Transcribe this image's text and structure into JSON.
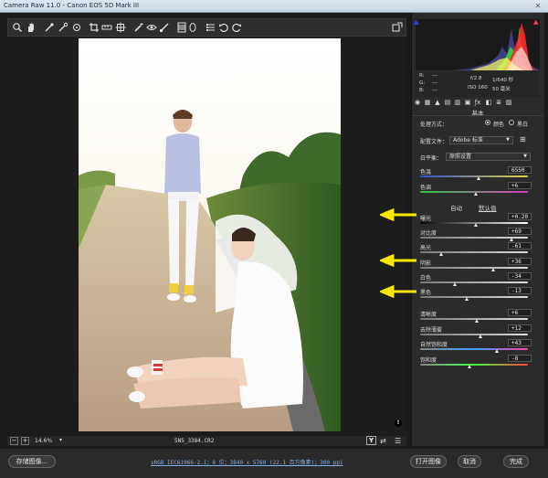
{
  "window": {
    "title": "Camera Raw 11.0  -  Canon EOS 5D Mark III",
    "close_glyph": "✕"
  },
  "toolbar": {
    "icons": [
      "zoom-icon",
      "hand-icon",
      "white-balance-icon",
      "color-sampler-icon",
      "targeted-adjustment-icon",
      "crop-icon",
      "straighten-icon",
      "transform-icon",
      "spot-removal-icon",
      "red-eye-icon",
      "adjustment-brush-icon",
      "graduated-filter-icon",
      "radial-filter-icon",
      "preferences-icon",
      "rotate-left-icon",
      "rotate-right-icon"
    ],
    "fullscreen_icon": "fullscreen-icon"
  },
  "preview": {
    "warning_glyph": "!"
  },
  "status": {
    "zoom_minus": "−",
    "zoom_plus": "+",
    "zoom": "14.6%",
    "zoom_arrow": "▾",
    "filename": "5N5_3384.CR2",
    "y_view": "Y",
    "compare_icon": "⇄",
    "settings_icon": "☰"
  },
  "bottom": {
    "save_label": "存储图像...",
    "workflow_link": "sRGB IEC61966-2.1；8 位；3840 x 5760 (22.1 百万像素)；300 ppi",
    "open_label": "打开图像",
    "cancel_label": "取消",
    "done_label": "完成"
  },
  "info": {
    "r_label": "R:",
    "r_val": "---",
    "g_label": "G:",
    "g_val": "---",
    "b_label": "B:",
    "b_val": "---",
    "aperture": "f/2.8",
    "shutter": "1/640 秒",
    "iso": "ISO 160",
    "focal": "50 毫米"
  },
  "panel": {
    "section_title": "基本",
    "treatment_label": "处理方式：",
    "color_label": "颜色",
    "bw_label": "黑白",
    "profile_label": "配置文件：",
    "profile_value": "Adobe 标准",
    "wb_label": "白平衡：",
    "wb_value": "原照设置",
    "auto_label": "自动",
    "default_label": "默认值",
    "sliders": {
      "temp": {
        "label": "色温",
        "value": "6550",
        "level": 0.55
      },
      "tint": {
        "label": "色调",
        "value": "+6",
        "level": 0.52
      },
      "exposure": {
        "label": "曝光",
        "value": "+0.20",
        "level": 0.52
      },
      "contrast": {
        "label": "对比度",
        "value": "+69",
        "level": 0.85
      },
      "highlights": {
        "label": "高光",
        "value": "-61",
        "level": 0.2
      },
      "shadows": {
        "label": "阴影",
        "value": "+36",
        "level": 0.68
      },
      "whites": {
        "label": "白色",
        "value": "-34",
        "level": 0.33
      },
      "blacks": {
        "label": "黑色",
        "value": "-13",
        "level": 0.44
      },
      "clarity": {
        "label": "清晰度",
        "value": "+6",
        "level": 0.53
      },
      "dehaze": {
        "label": "去除薄雾",
        "value": "+12",
        "level": 0.56
      },
      "vibrance": {
        "label": "自然饱和度",
        "value": "+43",
        "level": 0.72
      },
      "saturation": {
        "label": "饱和度",
        "value": "-8",
        "level": 0.46
      }
    }
  },
  "colors": {
    "accent_arrow": "#f5e600",
    "link": "#7fb0e8",
    "panel_bg": "#2b2b2b"
  }
}
